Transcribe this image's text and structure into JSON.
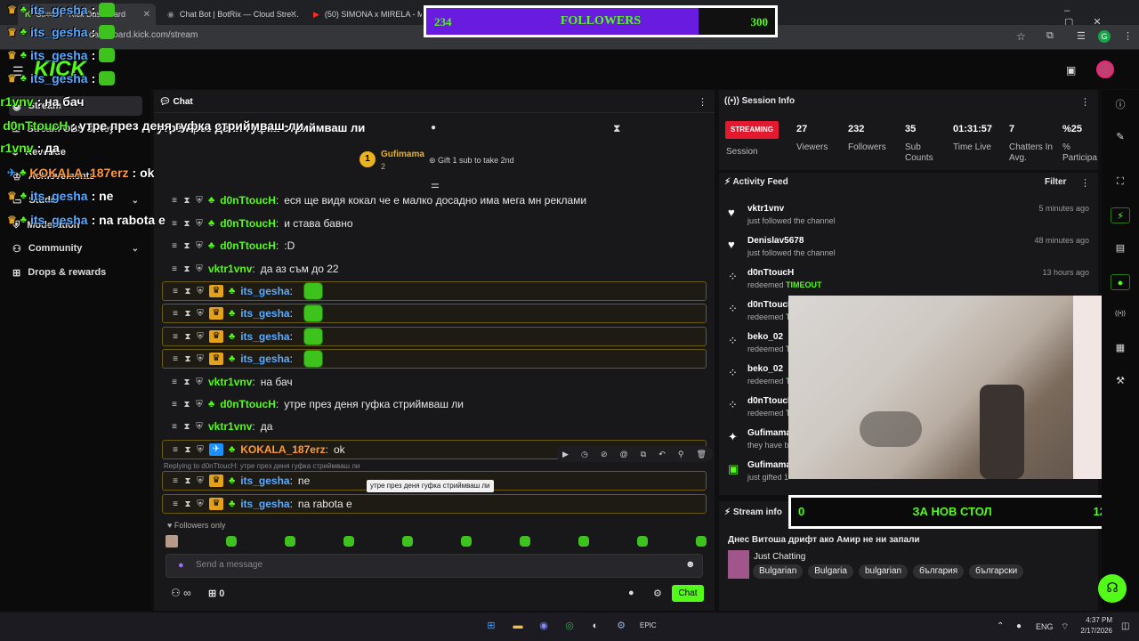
{
  "browser": {
    "tabs": [
      {
        "label": "Stream - Kick Dashboard"
      },
      {
        "label": "Chat Bot | BotRix — Cloud Stre…"
      },
      {
        "label": "(50) SIMONA x MIRELA - M…"
      }
    ],
    "url": "dashboard.kick.com/stream"
  },
  "followers_goal": {
    "current": "234",
    "label": "FOLLOWERS",
    "target": "300",
    "progress": 0.78
  },
  "overlay_chat": [
    {
      "user": "its_gesha",
      "text": ":"
    },
    {
      "user": "its_gesha",
      "text": ":"
    },
    {
      "user": "its_gesha",
      "text": ":"
    },
    {
      "user": "its_gesha",
      "text": ":"
    },
    {
      "user": "vktr1vnv",
      "text": ": на бач"
    },
    {
      "user": "d0nTtoucH",
      "text": ": утре през деня гуфка стриймваш ли"
    },
    {
      "user": "vktr1vnv",
      "text": ": да"
    },
    {
      "user": "KOKALA_187erz",
      "text": ": ok"
    },
    {
      "user": "its_gesha",
      "text": ": ne"
    },
    {
      "user": "its_gesha",
      "text": ": na rabota e"
    }
  ],
  "sidebar": {
    "brand": "KICK",
    "items": [
      {
        "label": "Stream"
      },
      {
        "label": "Stream OBS & Key"
      },
      {
        "label": "Revenue"
      },
      {
        "label": "Achievements"
      },
      {
        "label": "Studio"
      },
      {
        "label": "Moderation"
      },
      {
        "label": "Community"
      },
      {
        "label": "Drops & rewards"
      }
    ]
  },
  "chat": {
    "title": "Chat",
    "pinned": "утре през деня гуфка стриймваш ли",
    "gift_user": "Gufimama",
    "gift_count": "2",
    "gift_rank": "1",
    "gift_cta": "Gift 1 sub to take 2nd",
    "messages": [
      {
        "user": "d0nTtoucH",
        "text": "еся ще видя кокал че е малко досадно има мега мн реклами"
      },
      {
        "user": "d0nTtoucH",
        "text": "и става бавно"
      },
      {
        "user": "d0nTtoucH",
        "text": ":D"
      },
      {
        "user": "vktr1vnv",
        "text": "да аз съм до 22"
      },
      {
        "user": "its_gesha",
        "text": ""
      },
      {
        "user": "its_gesha",
        "text": ""
      },
      {
        "user": "its_gesha",
        "text": ""
      },
      {
        "user": "its_gesha",
        "text": ""
      },
      {
        "user": "vktr1vnv",
        "text": "на бач"
      },
      {
        "user": "d0nTtoucH",
        "text": "утре през деня гуфка стриймваш ли"
      },
      {
        "user": "vktr1vnv",
        "text": "да"
      },
      {
        "user": "KOKALA_187erz",
        "text": "ok"
      },
      {
        "user": "its_gesha",
        "text": "ne"
      },
      {
        "user": "its_gesha",
        "text": "na rabota e"
      }
    ],
    "reply_to": "Replying to d0nTtoucH: утре през деня гуфка стриймваш ли",
    "tooltip": "утре през деня гуфка стриймваш ли",
    "followers_only": "Followers only",
    "input_placeholder": "Send a message",
    "infinite": "∞",
    "gift_box_count": "0",
    "send_label": "Chat"
  },
  "session": {
    "title": "Session Info",
    "status": "STREAMING",
    "session_label": "Session",
    "stats": [
      {
        "value": "27",
        "label": "Viewers"
      },
      {
        "value": "232",
        "label": "Followers"
      },
      {
        "value": "35",
        "label": "Sub Counts"
      },
      {
        "value": "01:31:57",
        "label": "Time Live"
      },
      {
        "value": "7",
        "label": "Chatters In Avg."
      },
      {
        "value": "%25",
        "label": "% Participa"
      }
    ]
  },
  "activity": {
    "title": "Activity Feed",
    "filter": "Filter",
    "items": [
      {
        "name": "vktr1vnv",
        "sub": "just followed the channel",
        "time": "5 minutes ago",
        "icon": "heart-icon"
      },
      {
        "name": "Denislav5678",
        "sub": "just followed the channel",
        "time": "48 minutes ago",
        "icon": "heart-icon"
      },
      {
        "name": "d0nTtoucH",
        "sub": "redeemed",
        "highlight": "TIMEOUT",
        "time": "13 hours ago",
        "icon": "redeem-icon"
      },
      {
        "name": "d0nTtoucH",
        "sub": "redeemed",
        "highlight": "T",
        "time": "",
        "icon": "redeem-icon"
      },
      {
        "name": "beko_02",
        "sub": "redeemed",
        "highlight": "T",
        "time": "",
        "icon": "redeem-icon"
      },
      {
        "name": "beko_02",
        "sub": "redeemed",
        "highlight": "T",
        "time": "",
        "icon": "redeem-icon"
      },
      {
        "name": "d0nTtoucH",
        "sub": "redeemed",
        "highlight": "T",
        "time": "",
        "icon": "redeem-icon"
      },
      {
        "name": "Gufimama",
        "sub": "they have b",
        "time": "",
        "icon": "sparkle-icon"
      },
      {
        "name": "Gufimama",
        "sub": "just gifted 1",
        "time": "",
        "icon": "gift-icon"
      }
    ]
  },
  "stream_info": {
    "title": "Stream info",
    "stream_title": "Днес Витоша дрифт ако Амир не ни запали",
    "category": "Just Chatting",
    "tags": [
      "Bulgarian",
      "Bulgaria",
      "bulgarian",
      "българия",
      "български"
    ]
  },
  "goal_overlay": {
    "left": "0",
    "label": "ЗА НОВ СТОЛ",
    "right": "12"
  },
  "taskbar": {
    "lang": "ENG",
    "time": "4:37 PM",
    "date": "2/17/2026"
  },
  "colors": {
    "kick_green": "#53fc18",
    "streaming_red": "#e3192f",
    "goal_purple": "#6a1be0",
    "username_blue": "#5aa9ff"
  }
}
